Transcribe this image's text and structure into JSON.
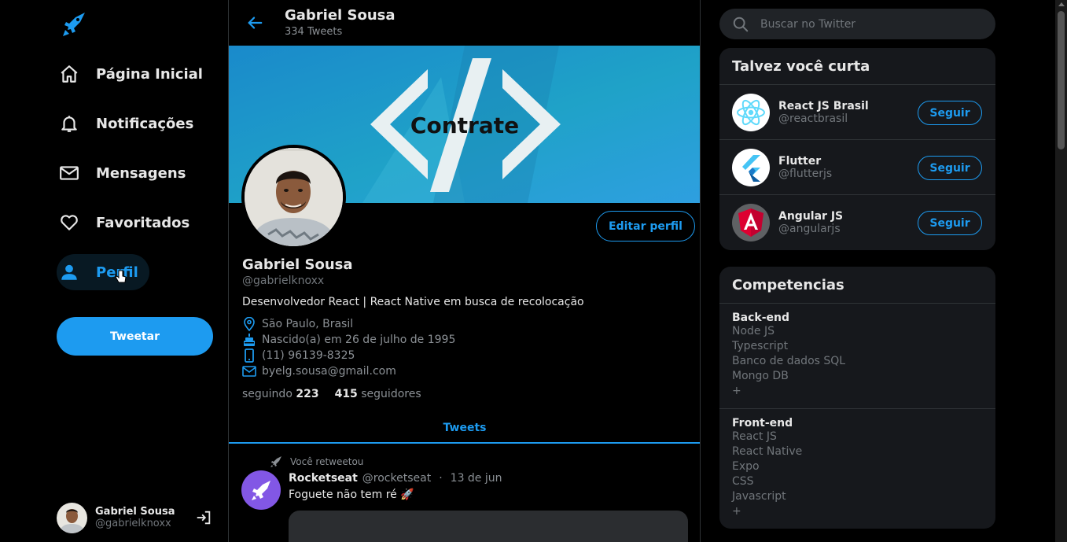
{
  "colors": {
    "accent": "#1d9bf0",
    "background": "#000000",
    "card": "#16181c",
    "rocketseat": "#8257e5"
  },
  "sidebar": {
    "logo_icon": "rocket-bird-logo",
    "nav": [
      {
        "label": "Página Inicial",
        "icon": "home-icon"
      },
      {
        "label": "Notificações",
        "icon": "bell-icon"
      },
      {
        "label": "Mensagens",
        "icon": "mail-icon"
      },
      {
        "label": "Favoritados",
        "icon": "heart-icon"
      },
      {
        "label": "Perfil",
        "icon": "person-icon",
        "active": true
      }
    ],
    "tweet_button": "Tweetar",
    "user": {
      "name": "Gabriel Sousa",
      "handle": "@gabrielknoxx"
    }
  },
  "header": {
    "name": "Gabriel Sousa",
    "tweets_count": "334 Tweets"
  },
  "banner": {
    "text": "Contrate"
  },
  "profile": {
    "edit_button": "Editar perfil",
    "name": "Gabriel Sousa",
    "handle": "@gabrielknoxx",
    "bio": "Desenvolvedor React | React Native em busca de recolocação",
    "location": "São Paulo, Brasil",
    "birth": "Nascido(a) em 26 de julho de 1995",
    "phone": "(11) 96139-8325",
    "email": "byelg.sousa@gmail.com",
    "following_label": "seguindo",
    "following_count": "223",
    "followers_count": "415",
    "followers_label": "seguidores"
  },
  "tabs": {
    "tweets": "Tweets"
  },
  "tweet": {
    "retweet_label": "Você retweetou",
    "author": "Rocketseat",
    "handle": "@rocketseat",
    "separator": "·",
    "date": "13 de jun",
    "text": "Foguete não tem ré 🚀"
  },
  "search": {
    "placeholder": "Buscar no Twitter"
  },
  "suggestions": {
    "title": "Talvez você curta",
    "follow_label": "Seguir",
    "items": [
      {
        "name": "React JS Brasil",
        "handle": "@reactbrasil"
      },
      {
        "name": "Flutter",
        "handle": "@flutterjs"
      },
      {
        "name": "Angular JS",
        "handle": "@angularjs"
      }
    ]
  },
  "competencias": {
    "title": "Competencias",
    "sections": [
      {
        "title": "Back-end",
        "items": [
          "Node JS",
          "Typescript",
          "Banco de dados SQL",
          "Mongo DB",
          "+"
        ]
      },
      {
        "title": "Front-end",
        "items": [
          "React JS",
          "React Native",
          "Expo",
          "CSS",
          "Javascript",
          "+"
        ]
      }
    ]
  }
}
